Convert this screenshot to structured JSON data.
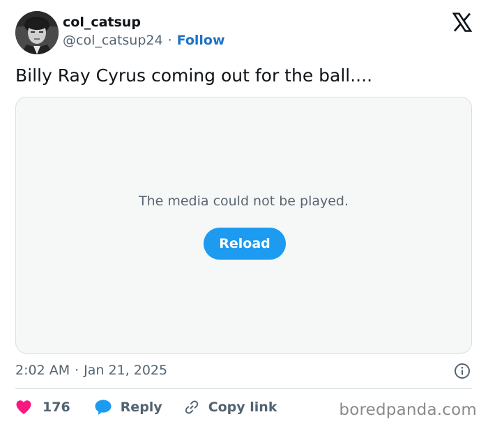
{
  "author": {
    "display_name": "col_catsup",
    "handle": "@col_catsup24",
    "separator": "·",
    "follow_label": "Follow",
    "avatar_icon": "avatar-photo"
  },
  "header": {
    "logo_icon": "x-logo-icon"
  },
  "tweet": {
    "text": "Billy Ray Cyrus coming out for the ball...."
  },
  "media": {
    "message": "The media could not be played.",
    "reload_label": "Reload"
  },
  "meta": {
    "time": "2:02 AM",
    "separator": "·",
    "date": "Jan 21, 2025",
    "info_icon": "info-icon"
  },
  "actions": {
    "like_count": "176",
    "reply_label": "Reply",
    "copy_link_label": "Copy link"
  },
  "watermark": {
    "text": "boredpanda.com"
  },
  "colors": {
    "accent": "#1d9bf0",
    "follow": "#1d72c8",
    "like": "#f91880",
    "secondary_text": "#536471",
    "media_bg": "#f6f8f8"
  }
}
